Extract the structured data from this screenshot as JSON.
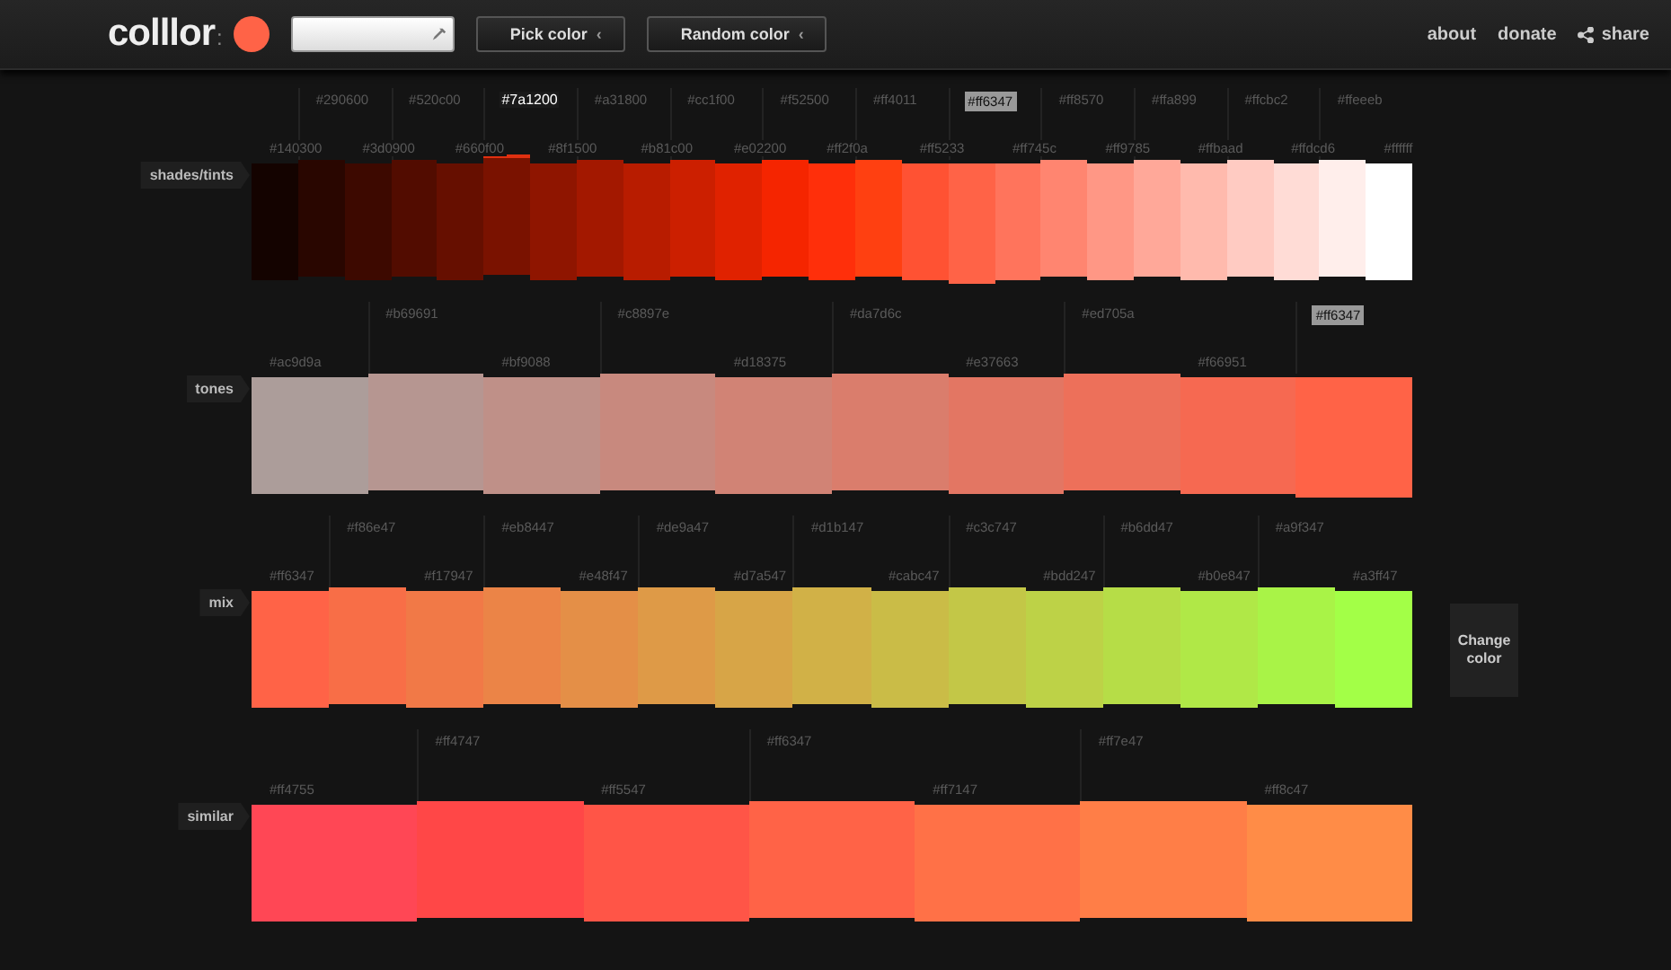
{
  "header": {
    "logo": "colllor",
    "logo_mark": ":",
    "color_field": {
      "kind": "eyedropper"
    },
    "buttons": [
      {
        "label": "Pick color",
        "caret": "‹"
      },
      {
        "label": "Random color",
        "caret": "‹"
      }
    ],
    "nav": [
      {
        "label": "about",
        "kind": "link"
      },
      {
        "label": "donate",
        "kind": "link"
      },
      {
        "label": "share",
        "kind": "share"
      }
    ]
  },
  "rows": [
    {
      "label": "shades/tints",
      "swatches": [
        {
          "hex": "#140300",
          "hovered": false,
          "base": false
        },
        {
          "hex": "#290600",
          "hovered": false,
          "base": false
        },
        {
          "hex": "#3d0900",
          "hovered": false,
          "base": false
        },
        {
          "hex": "#520c00",
          "hovered": false,
          "base": false
        },
        {
          "hex": "#660f00",
          "hovered": false,
          "base": false
        },
        {
          "hex": "#7a1200",
          "hovered": true,
          "base": false
        },
        {
          "hex": "#8f1500",
          "hovered": false,
          "base": false
        },
        {
          "hex": "#a31800",
          "hovered": false,
          "base": false
        },
        {
          "hex": "#b81c00",
          "hovered": false,
          "base": false
        },
        {
          "hex": "#cc1f00",
          "hovered": false,
          "base": false
        },
        {
          "hex": "#e02200",
          "hovered": false,
          "base": false
        },
        {
          "hex": "#f52500",
          "hovered": false,
          "base": false
        },
        {
          "hex": "#ff2f0a",
          "hovered": false,
          "base": false
        },
        {
          "hex": "#ff4011",
          "hovered": false,
          "base": false
        },
        {
          "hex": "#ff5233",
          "hovered": false,
          "base": false
        },
        {
          "hex": "#ff6347",
          "hovered": false,
          "base": true
        },
        {
          "hex": "#ff745c",
          "hovered": false,
          "base": false
        },
        {
          "hex": "#ff8570",
          "hovered": false,
          "base": false
        },
        {
          "hex": "#ff9785",
          "hovered": false,
          "base": false
        },
        {
          "hex": "#ffa899",
          "hovered": false,
          "base": false
        },
        {
          "hex": "#ffbaad",
          "hovered": false,
          "base": false
        },
        {
          "hex": "#ffcbc2",
          "hovered": false,
          "base": false
        },
        {
          "hex": "#ffdcd6",
          "hovered": false,
          "base": false
        },
        {
          "hex": "#ffeeeb",
          "hovered": false,
          "base": false
        },
        {
          "hex": "#ffffff",
          "hovered": false,
          "base": false
        }
      ]
    },
    {
      "label": "tones",
      "swatches": [
        {
          "hex": "#ac9d9a",
          "hovered": false,
          "base": false
        },
        {
          "hex": "#b69691",
          "hovered": false,
          "base": false
        },
        {
          "hex": "#bf9088",
          "hovered": false,
          "base": false
        },
        {
          "hex": "#c8897e",
          "hovered": false,
          "base": false
        },
        {
          "hex": "#d18375",
          "hovered": false,
          "base": false
        },
        {
          "hex": "#da7d6c",
          "hovered": false,
          "base": false
        },
        {
          "hex": "#e37663",
          "hovered": false,
          "base": false
        },
        {
          "hex": "#ed705a",
          "hovered": false,
          "base": false
        },
        {
          "hex": "#f66951",
          "hovered": false,
          "base": false
        },
        {
          "hex": "#ff6347",
          "hovered": false,
          "base": true
        }
      ]
    },
    {
      "label": "mix",
      "swatches": [
        {
          "hex": "#ff6347",
          "hovered": false,
          "base": false
        },
        {
          "hex": "#f86e47",
          "hovered": false,
          "base": false
        },
        {
          "hex": "#f17947",
          "hovered": false,
          "base": false
        },
        {
          "hex": "#eb8447",
          "hovered": false,
          "base": false
        },
        {
          "hex": "#e48f47",
          "hovered": false,
          "base": false
        },
        {
          "hex": "#de9a47",
          "hovered": false,
          "base": false
        },
        {
          "hex": "#d7a547",
          "hovered": false,
          "base": false
        },
        {
          "hex": "#d1b147",
          "hovered": false,
          "base": false
        },
        {
          "hex": "#cabc47",
          "hovered": false,
          "base": false
        },
        {
          "hex": "#c3c747",
          "hovered": false,
          "base": false
        },
        {
          "hex": "#bdd247",
          "hovered": false,
          "base": false
        },
        {
          "hex": "#b6dd47",
          "hovered": false,
          "base": false
        },
        {
          "hex": "#b0e847",
          "hovered": false,
          "base": false
        },
        {
          "hex": "#a9f347",
          "hovered": false,
          "base": false
        },
        {
          "hex": "#a3ff47",
          "hovered": false,
          "base": false
        }
      ],
      "action": "Change color"
    },
    {
      "label": "similar",
      "swatches": [
        {
          "hex": "#ff4755",
          "hovered": false,
          "base": false
        },
        {
          "hex": "#ff4747",
          "hovered": false,
          "base": false
        },
        {
          "hex": "#ff5547",
          "hovered": false,
          "base": false
        },
        {
          "hex": "#ff6347",
          "hovered": false,
          "base": false
        },
        {
          "hex": "#ff7147",
          "hovered": false,
          "base": false
        },
        {
          "hex": "#ff7e47",
          "hovered": false,
          "base": false
        },
        {
          "hex": "#ff8c47",
          "hovered": false,
          "base": false
        }
      ]
    }
  ]
}
